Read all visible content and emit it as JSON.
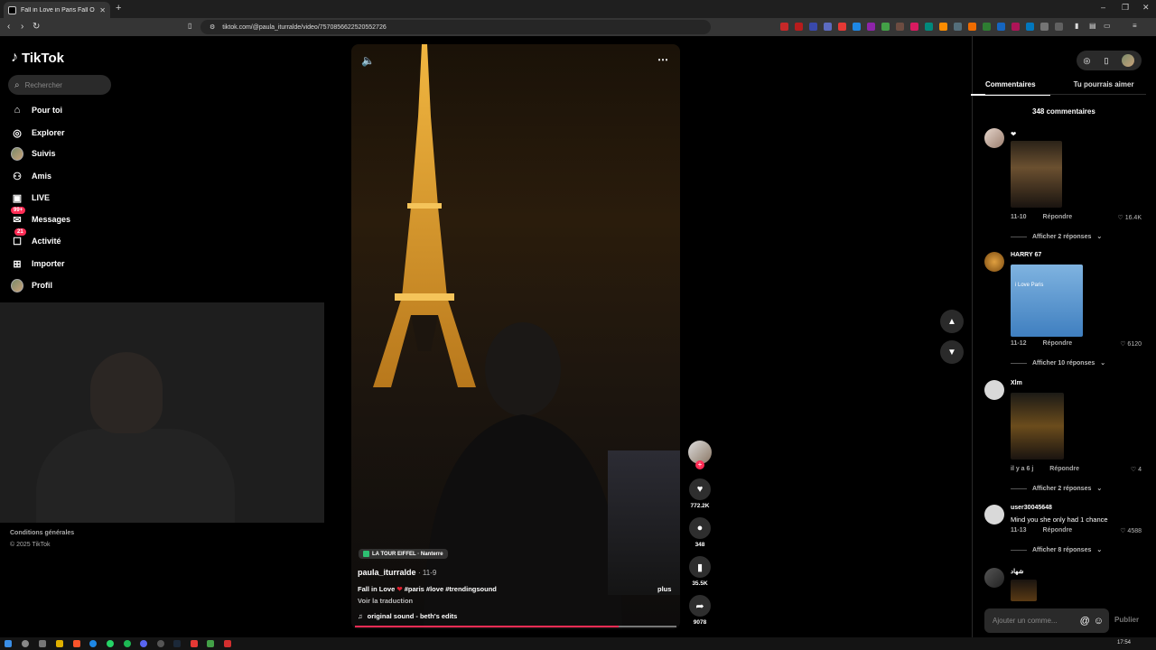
{
  "browser": {
    "tab_title": "Fall in Love in Paris Fall Outfi",
    "tab_close": "✕",
    "new_tab": "+",
    "url": "tiktok.com/@paula_iturralde/video/7570856622520552726"
  },
  "sidebar": {
    "logo_text": "TikTok",
    "search_placeholder": "Rechercher",
    "items": [
      {
        "label": "Pour toi",
        "icon": "home-icon"
      },
      {
        "label": "Explorer",
        "icon": "compass-icon"
      },
      {
        "label": "Suivis",
        "icon": "avatar"
      },
      {
        "label": "Amis",
        "icon": "friends-icon"
      },
      {
        "label": "LIVE",
        "icon": "live-icon"
      },
      {
        "label": "Messages",
        "icon": "messages-icon",
        "badge": "99+"
      },
      {
        "label": "Activité",
        "icon": "activity-icon",
        "badge": "21"
      },
      {
        "label": "Importer",
        "icon": "upload-icon"
      },
      {
        "label": "Profil",
        "icon": "avatar"
      }
    ],
    "footer_terms": "Conditions générales",
    "footer_copyright": "© 2025 TikTok"
  },
  "video": {
    "location": "LA TOUR EIFFEL · Nanterre",
    "author": "paula_iturralde",
    "date": "· 11-9",
    "caption_start": "Fall in Love",
    "caption_heart": "❤",
    "caption_tags": "#paris #love #trendingsound",
    "more": "plus",
    "translate": "Voir la traduction",
    "sound": "original sound - beth's edits",
    "progress": 0.82
  },
  "actions": {
    "likes": "772.2K",
    "comments": "348",
    "saves": "35.5K",
    "shares": "9078"
  },
  "panel": {
    "tab_comments": "Commentaires",
    "tab_suggest": "Tu pourrais aimer",
    "comment_count": "348 commentaires",
    "comments": [
      {
        "name": "",
        "text": "❤",
        "date": "11-10",
        "reply": "Répondre",
        "likes": "16.4K",
        "replies": "Afficher 2 réponses"
      },
      {
        "name": "HARRY 67",
        "image_text": "i Love Paris",
        "date": "11-12",
        "reply": "Répondre",
        "likes": "6120",
        "replies": "Afficher 10 réponses"
      },
      {
        "name": "Xlm",
        "date": "il y a 6 j",
        "reply": "Répondre",
        "likes": "4",
        "replies": "Afficher 2 réponses"
      },
      {
        "name": "user30045648",
        "text": "Mind you she only had 1 chance",
        "date": "11-13",
        "reply": "Répondre",
        "likes": "4588",
        "replies": "Afficher 8 réponses"
      },
      {
        "name": "شهاد"
      }
    ],
    "input_placeholder": "Ajouter un comme...",
    "publish": "Publier"
  },
  "taskbar": {
    "time": "17:54"
  },
  "colors": {
    "accent": "#fe2c55",
    "background": "#000000",
    "panel_input": "#2a2a2a"
  }
}
